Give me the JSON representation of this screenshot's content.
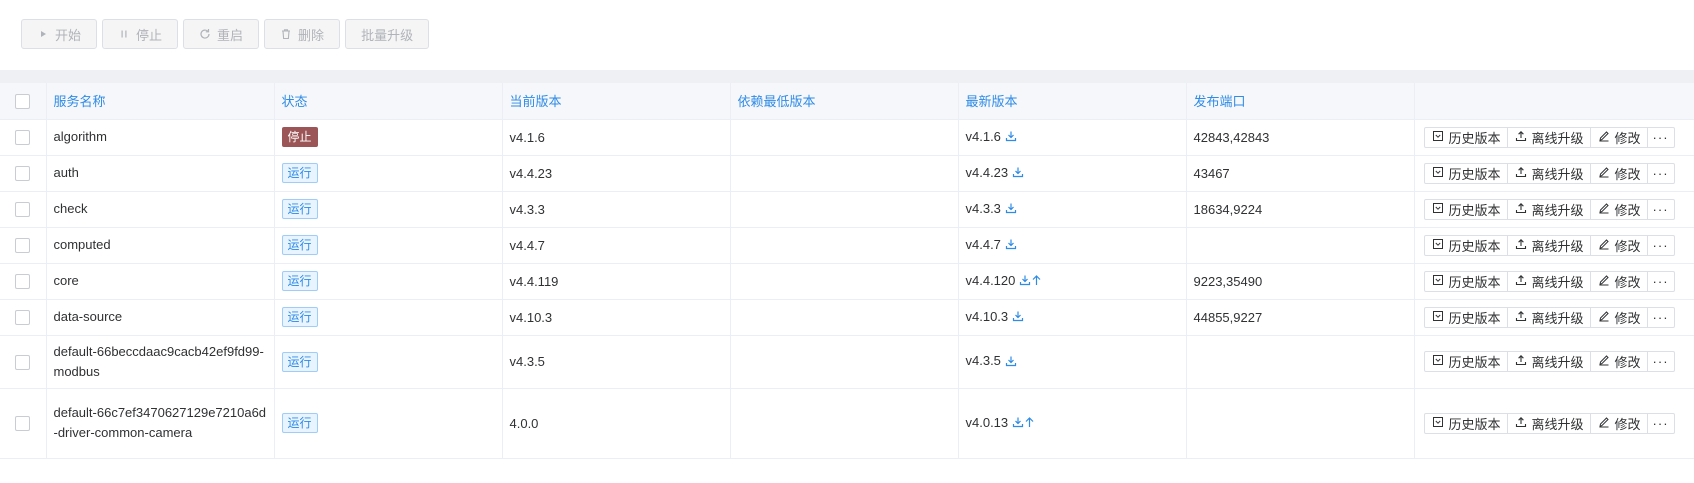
{
  "toolbar": {
    "start_label": "开始",
    "stop_label": "停止",
    "restart_label": "重启",
    "delete_label": "删除",
    "batch_upgrade_label": "批量升级"
  },
  "table": {
    "headers": {
      "name": "服务名称",
      "status": "状态",
      "current_version": "当前版本",
      "min_dependency_version": "依赖最低版本",
      "latest_version": "最新版本",
      "ports": "发布端口"
    },
    "actions": {
      "history_label": "历史版本",
      "offline_upgrade_label": "离线升级",
      "edit_label": "修改",
      "more_label": "···"
    },
    "rows": [
      {
        "name": "algorithm",
        "status": "停止",
        "status_type": "stopped",
        "current": "v4.1.6",
        "min_dep": "",
        "latest": "v4.1.6",
        "upgradable": false,
        "ports": "42843,42843"
      },
      {
        "name": "auth",
        "status": "运行",
        "status_type": "running",
        "current": "v4.4.23",
        "min_dep": "",
        "latest": "v4.4.23",
        "upgradable": false,
        "ports": "43467"
      },
      {
        "name": "check",
        "status": "运行",
        "status_type": "running",
        "current": "v4.3.3",
        "min_dep": "",
        "latest": "v4.3.3",
        "upgradable": false,
        "ports": "18634,9224"
      },
      {
        "name": "computed",
        "status": "运行",
        "status_type": "running",
        "current": "v4.4.7",
        "min_dep": "",
        "latest": "v4.4.7",
        "upgradable": false,
        "ports": ""
      },
      {
        "name": "core",
        "status": "运行",
        "status_type": "running",
        "current": "v4.4.119",
        "min_dep": "",
        "latest": "v4.4.120",
        "upgradable": true,
        "ports": "9223,35490"
      },
      {
        "name": "data-source",
        "status": "运行",
        "status_type": "running",
        "current": "v4.10.3",
        "min_dep": "",
        "latest": "v4.10.3",
        "upgradable": false,
        "ports": "44855,9227"
      },
      {
        "name": "default-66beccdaac9cacb42ef9fd99-modbus",
        "status": "运行",
        "status_type": "running",
        "current": "v4.3.5",
        "min_dep": "",
        "latest": "v4.3.5",
        "upgradable": false,
        "ports": ""
      },
      {
        "name": "default-66c7ef3470627129e7210a6d-driver-common-camera",
        "status": "运行",
        "status_type": "running",
        "current": "4.0.0",
        "min_dep": "",
        "latest": "v4.0.13",
        "upgradable": true,
        "ports": ""
      }
    ]
  },
  "colors": {
    "accent": "#2f8be6",
    "stopped": "#9b5556",
    "running_bg": "#e8f4ff"
  }
}
